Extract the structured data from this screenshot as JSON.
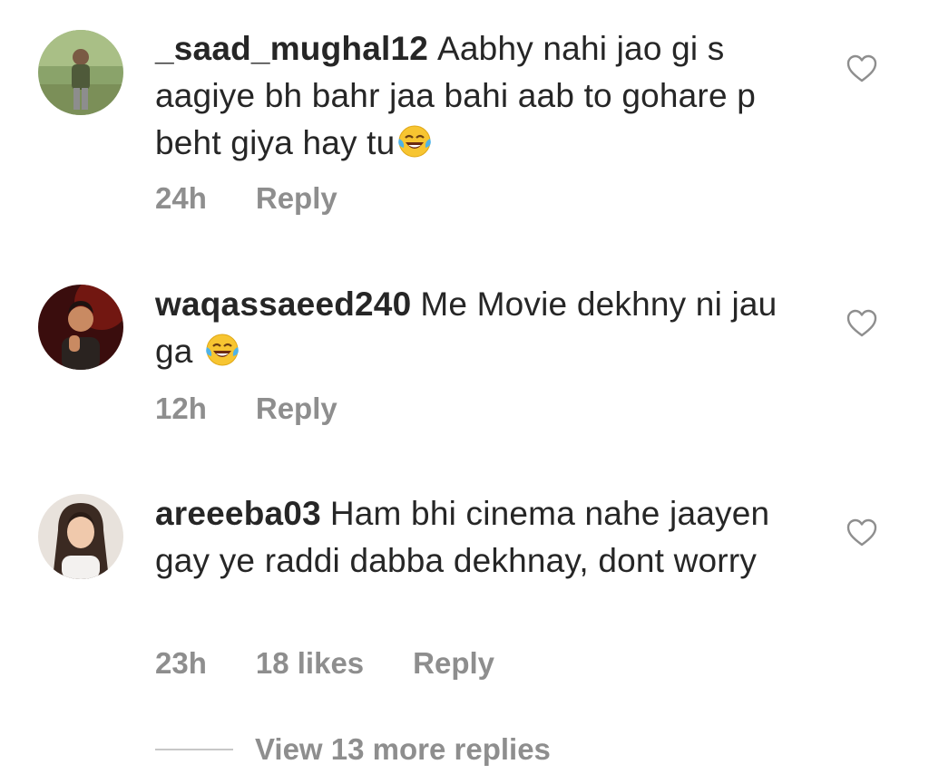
{
  "comments": [
    {
      "username": "_saad_mughal12",
      "text": "Aabhy nahi jao gi s aagiye bh bahr jaa bahi aab to gohare p beht giya hay tu",
      "emoji": "face-with-tears-of-joy",
      "time": "24h",
      "reply_label": "Reply"
    },
    {
      "username": "waqassaeed240",
      "text": "Me Movie dekhny ni jau ga ",
      "emoji": "face-with-tears-of-joy",
      "time": "12h",
      "reply_label": "Reply"
    },
    {
      "username": "areeeba03",
      "text": "Ham bhi cinema nahe jaayen gay ye raddi dabba dekhnay, dont worry",
      "time": "23h",
      "likes": "18 likes",
      "reply_label": "Reply"
    }
  ],
  "view_more_replies": "View 13 more replies",
  "colors": {
    "text": "#262626",
    "meta": "#8e8e8e",
    "divider": "#c7c7c7"
  },
  "icons": {
    "like": "heart-outline-icon",
    "emoji": "face-with-tears-of-joy"
  }
}
